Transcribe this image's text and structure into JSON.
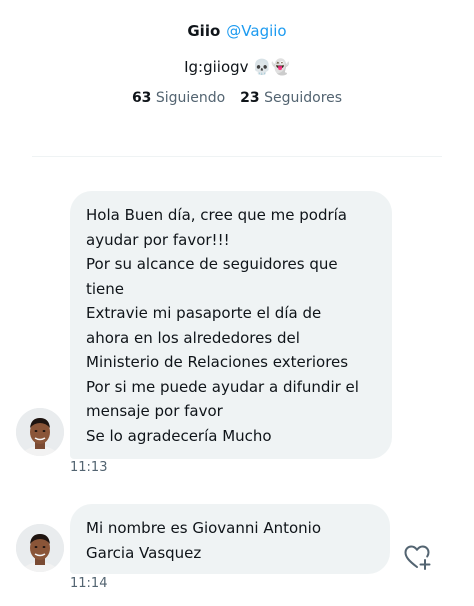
{
  "profile": {
    "display_name": "Giio",
    "handle": "@Vagiio",
    "bio_text": "Ig:giiogv",
    "bio_emojis": "💀👻",
    "following_count": "63",
    "following_label": "Siguiendo",
    "followers_count": "23",
    "followers_label": "Seguidores"
  },
  "messages": [
    {
      "lines": [
        "Hola Buen día, cree que me podría",
        "ayudar por favor!!!",
        "Por su alcance de seguidores que",
        "tiene",
        "Extravie mi pasaporte el día de",
        "ahora en los alrededores del",
        "Ministerio de Relaciones exteriores",
        "Por si me puede ayudar a difundir el",
        "mensaje por favor",
        "Se lo agradecería Mucho"
      ],
      "time": "11:13"
    },
    {
      "lines": [
        "Mi nombre es Giovanni Antonio",
        "Garcia Vasquez"
      ],
      "time": "11:14"
    }
  ],
  "icons": {
    "avatar": "avatar-photo",
    "react": "heart-plus-icon"
  },
  "colors": {
    "handle": "#1d9bf0",
    "bubble_bg": "#eff3f4",
    "secondary_text": "#536471",
    "primary_text": "#0f1419"
  }
}
